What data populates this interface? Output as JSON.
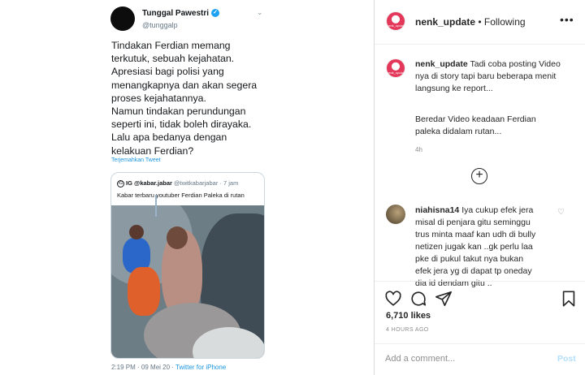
{
  "tweet": {
    "author_name": "Tunggal Pawestri",
    "verified_mark": "✓",
    "handle": "@tunggalp",
    "menu_glyph": "⌄",
    "text_lines": [
      "Tindakan Ferdian memang",
      "terkutuk, sebuah kejahatan.",
      "Apresiasi bagi polisi yang",
      "menangkapnya dan akan segera",
      "proses kejahatannya.",
      "Namun tindakan perundungan",
      "seperti ini, tidak boleh dirayaka.",
      "Lalu apa bedanya dengan",
      "kelakuan Ferdian?"
    ],
    "translate_label": "Terjemahkan Tweet",
    "quote": {
      "icon_glyph": "IG",
      "name": "IG @kabar.jabar",
      "meta": " @twitkabarjabar · 7 jam",
      "text": "Kabar terbaru youtuber Ferdian Paleka di rutan"
    },
    "timestamp": "2:19 PM · 09 Mei 20 · ",
    "source": "Twitter for iPhone"
  },
  "instagram": {
    "avatar_text": "nenk_update",
    "header": {
      "username": "nenk_update",
      "follow_status": " • Following",
      "more_glyph": "•••"
    },
    "caption": {
      "username": "nenk_update",
      "lines": [
        " Tadi coba posting Video",
        "nya di story tapi baru beberapa menit",
        "langsung ke report..."
      ],
      "extra_lines": [
        "Beredar Video keadaan Ferdian",
        "paleka didalam rutan..."
      ],
      "time": "4h"
    },
    "load_more_glyph": "+",
    "comment": {
      "username": "niahisna14",
      "lines": [
        " Iya cukup efek jera",
        "misal di penjara gitu seminggu",
        "trus minta maaf kan udh di bully",
        "netizen jugak kan ..gk perlu laa",
        "pke di pukul takut nya bukan",
        "efek jera yg di dapat tp oneday",
        "dia id dendam gitu .."
      ],
      "heart_glyph": "♡"
    },
    "likes": "6,710 likes",
    "time_ago": "4 HOURS AGO",
    "add_comment_placeholder": "Add a comment...",
    "post_label": "Post"
  },
  "colors": {
    "twitter_blue": "#1b95e0",
    "verified_blue": "#1da1f2",
    "ig_avatar": "#e3385a",
    "post_disabled": "#b2dffc"
  }
}
